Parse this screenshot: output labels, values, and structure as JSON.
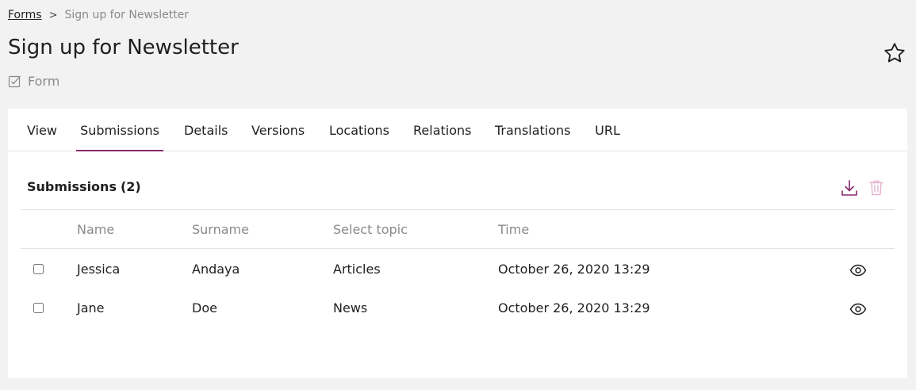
{
  "breadcrumb": {
    "parent": "Forms",
    "separator": ">",
    "current": "Sign up for Newsletter"
  },
  "header": {
    "title": "Sign up for Newsletter",
    "content_type": "Form",
    "content_type_icon": "checkbox-form-icon",
    "bookmark_icon": "star-icon"
  },
  "tabs": [
    {
      "label": "View"
    },
    {
      "label": "Submissions",
      "active": true
    },
    {
      "label": "Details"
    },
    {
      "label": "Versions"
    },
    {
      "label": "Locations"
    },
    {
      "label": "Relations"
    },
    {
      "label": "Translations"
    },
    {
      "label": "URL"
    }
  ],
  "submissions": {
    "title": "Submissions",
    "count": "(2)",
    "actions": [
      {
        "icon": "download-icon",
        "enabled": true
      },
      {
        "icon": "trash-icon",
        "enabled": false
      }
    ],
    "columns": [
      "Name",
      "Surname",
      "Select topic",
      "Time"
    ],
    "rows": [
      {
        "name": "Jessica",
        "surname": "Andaya",
        "topic": "Articles",
        "time": "October 26, 2020 13:29"
      },
      {
        "name": "Jane",
        "surname": "Doe",
        "topic": "News",
        "time": "October 26, 2020 13:29"
      }
    ]
  },
  "colors": {
    "accent": "#8a2a6b",
    "accent_disabled": "#e3b3cd",
    "muted_text": "#8a8a8a",
    "divider": "#e2e2e2",
    "background": "#f2f2f2"
  }
}
